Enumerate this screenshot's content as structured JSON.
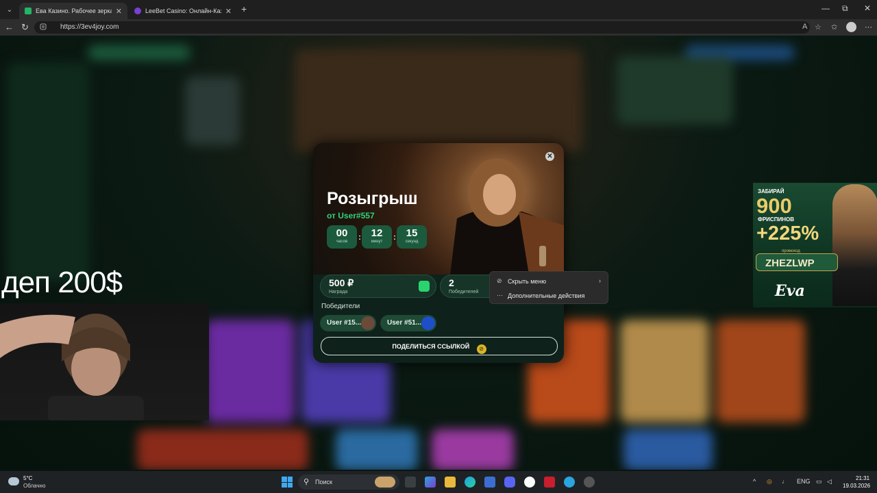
{
  "browser": {
    "tabs": [
      {
        "title": "Ева Казино. Рабочее зеркало. Оф",
        "active": true
      },
      {
        "title": "LeeBet Casino: Онлайн-Казино с",
        "active": false
      }
    ],
    "url": "https://3ev4joy.com"
  },
  "overlay": {
    "stream_text": "деп 200$"
  },
  "giveaway": {
    "title": "Розыгрыш",
    "from": "от User#557",
    "timer": [
      {
        "value": "00",
        "label": "часов"
      },
      {
        "value": "12",
        "label": "минут"
      },
      {
        "value": "15",
        "label": "секунд"
      }
    ],
    "timer_sep": ":",
    "prize_value": "500 ₽",
    "prize_caption": "Награда",
    "winners_count": "2",
    "winners_caption": "Победителей",
    "winners_label": "Победители",
    "winners": [
      "User #15...",
      "User #51..."
    ],
    "share_label": "ПОДЕЛИТЬСЯ ССЫЛКОЙ"
  },
  "context_menu": {
    "items": [
      {
        "label": "Скрыть меню",
        "icon": "hide-icon"
      },
      {
        "label": "Дополнительные действия",
        "icon": "more-icon"
      }
    ]
  },
  "promo": {
    "line1": "ЗАБИРАЙ",
    "amount": "900",
    "line2": "ФРИСПИНОВ",
    "bonus": "+225%",
    "promo_label": "промокод",
    "code": "ZHEZLWP",
    "brand": "Eva"
  },
  "taskbar": {
    "temp": "5°C",
    "weather": "Облачно",
    "search": "Поиск",
    "lang": "ENG",
    "time": "21:31",
    "date": "19.03.2026"
  },
  "colors": {
    "accent_green": "#2fd17a",
    "modal_bg": "#0f211b",
    "timer_bg": "#1c5a3e",
    "promo_gold": "#e9cc6a"
  }
}
